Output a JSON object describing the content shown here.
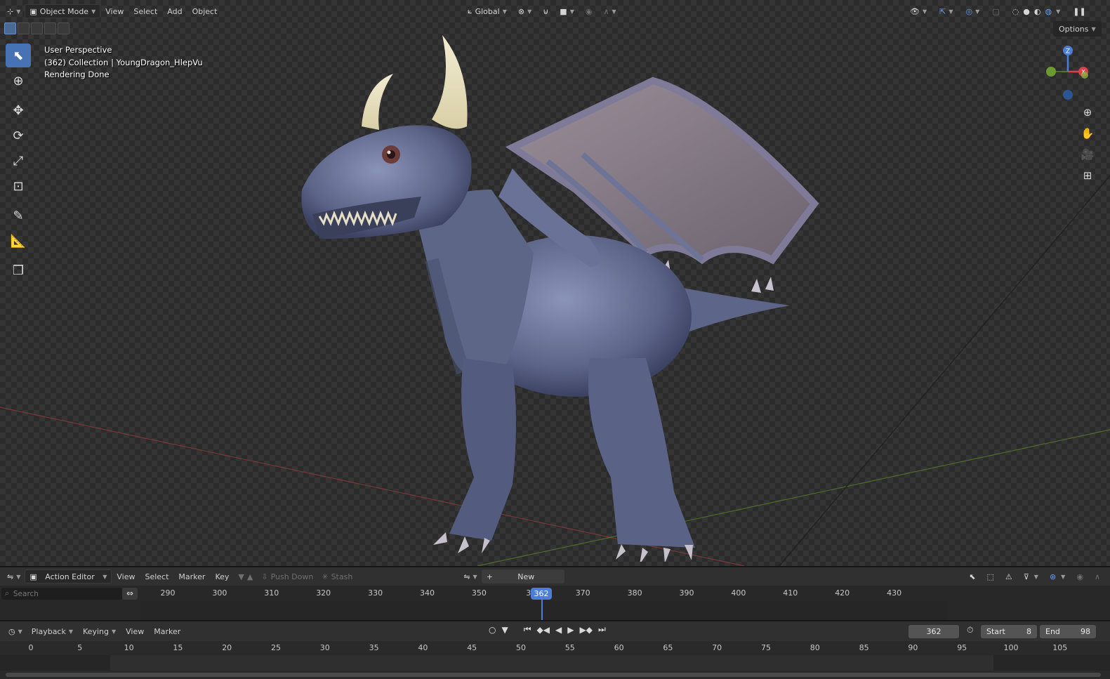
{
  "viewport": {
    "header": {
      "mode_label": "Object Mode",
      "menus": [
        "View",
        "Select",
        "Add",
        "Object"
      ],
      "transform_orientation": "Global"
    },
    "options_label": "Options",
    "info": {
      "line1": "User Perspective",
      "line2": "(362) Collection | YoungDragon_HlepVu",
      "line3": "Rendering Done"
    },
    "gizmo": {
      "z": "Z",
      "x": "X"
    }
  },
  "action_editor": {
    "editor_label": "Action Editor",
    "menus": [
      "View",
      "Select",
      "Marker",
      "Key"
    ],
    "push_down_label": "Push Down",
    "stash_label": "Stash",
    "new_label": "New",
    "search_placeholder": "Search",
    "ruler_ticks": [
      "290",
      "300",
      "310",
      "320",
      "330",
      "340",
      "350",
      "36",
      "370",
      "380",
      "390",
      "400",
      "410",
      "420",
      "430"
    ],
    "current_frame": "362"
  },
  "timeline": {
    "menus": [
      "Playback",
      "Keying",
      "View",
      "Marker"
    ],
    "current_frame": "362",
    "start_label": "Start",
    "start_value": "8",
    "end_label": "End",
    "end_value": "98",
    "ruler_ticks": [
      "0",
      "5",
      "10",
      "15",
      "20",
      "25",
      "30",
      "35",
      "40",
      "45",
      "50",
      "55",
      "60",
      "65",
      "70",
      "75",
      "80",
      "85",
      "90",
      "95",
      "100",
      "105"
    ]
  }
}
